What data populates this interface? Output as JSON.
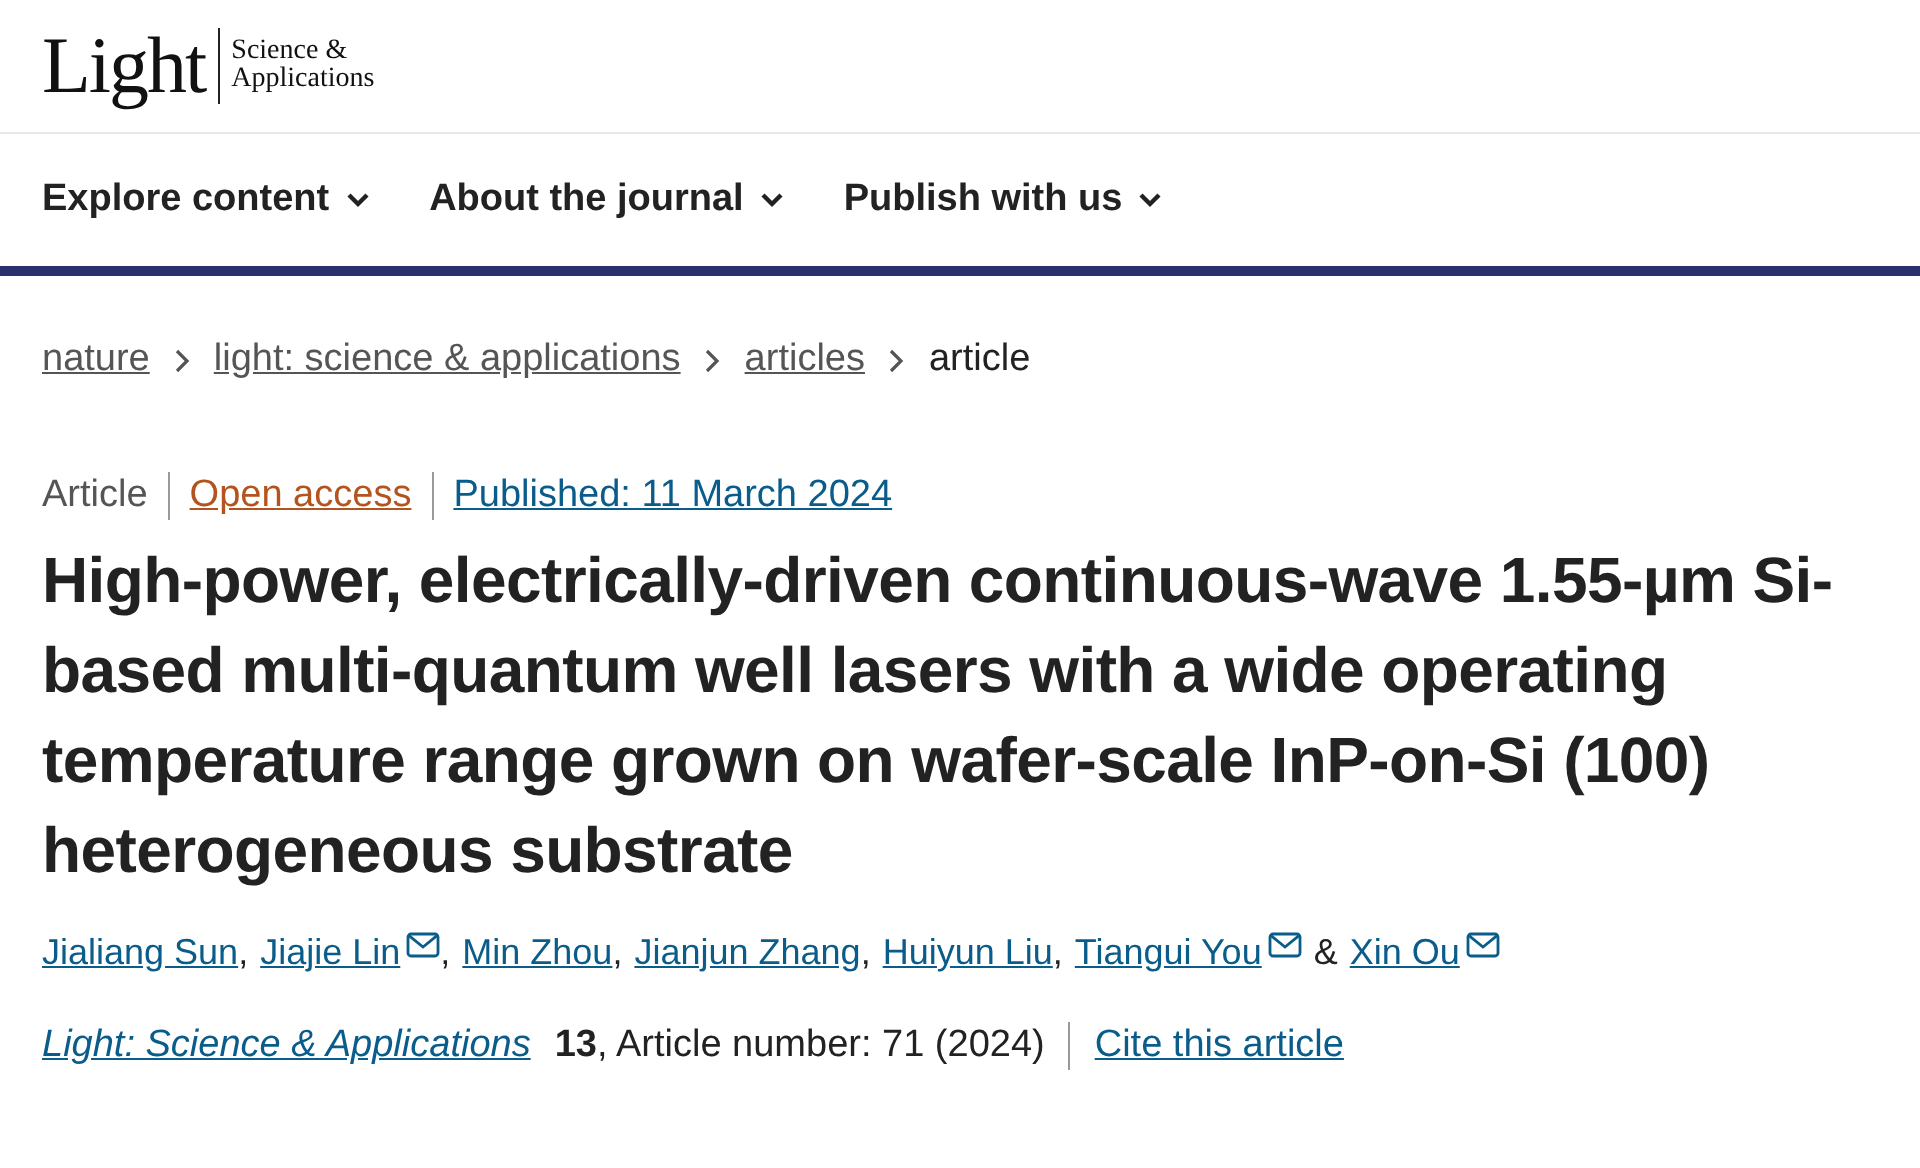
{
  "logo": {
    "name": "Light",
    "subtitle_lines": [
      "Science &",
      "Applications"
    ]
  },
  "nav": [
    {
      "label": "Explore content"
    },
    {
      "label": "About the journal"
    },
    {
      "label": "Publish with us"
    }
  ],
  "breadcrumbs": [
    {
      "label": "nature",
      "link": true
    },
    {
      "label": "light: science & applications",
      "link": true
    },
    {
      "label": "articles",
      "link": true
    },
    {
      "label": "article",
      "link": false
    }
  ],
  "meta": {
    "type": "Article",
    "access": "Open access",
    "published": "Published: 11 March 2024"
  },
  "title": "High-power, electrically-driven continuous-wave 1.55-µm Si-based multi-quantum well lasers with a wide operating temperature range grown on wafer-scale InP-on-Si (100) heterogeneous substrate",
  "authors": [
    {
      "name": "Jialiang Sun",
      "email": false,
      "separator": ","
    },
    {
      "name": "Jiajie Lin",
      "email": true,
      "separator": ","
    },
    {
      "name": "Min Zhou",
      "email": false,
      "separator": ","
    },
    {
      "name": "Jianjun Zhang",
      "email": false,
      "separator": ","
    },
    {
      "name": "Huiyun Liu",
      "email": false,
      "separator": ","
    },
    {
      "name": "Tiangui You",
      "email": true,
      "separator": "&"
    },
    {
      "name": "Xin Ou",
      "email": true
    }
  ],
  "citation": {
    "journal": "Light: Science & Applications",
    "details": "**13**, Article number: 71 (2024)",
    "cite_link": "Cite this article"
  }
}
